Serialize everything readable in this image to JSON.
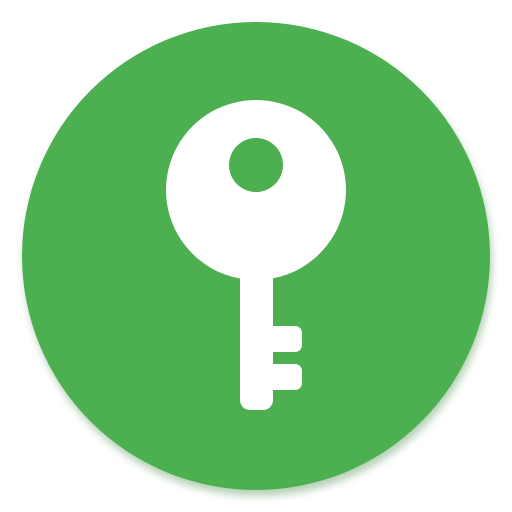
{
  "app_icon": {
    "icon": "key-icon",
    "colors": {
      "background_circle": "#4CAF50",
      "shadow": "#2E7D32",
      "key": "#FFFFFF"
    }
  }
}
